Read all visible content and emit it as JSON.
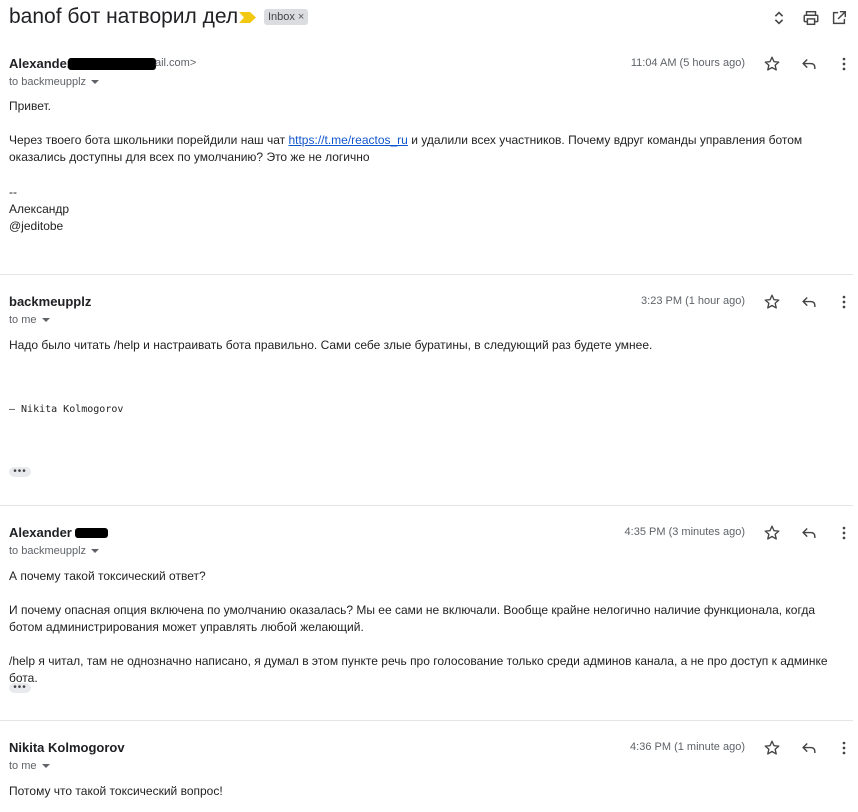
{
  "subject": {
    "title": "banof бот натворил дел",
    "label": "Inbox",
    "label_remove": "×"
  },
  "colors": {
    "importance": "#f2c811",
    "link": "#1155cc"
  },
  "top_actions": [
    "expand-collapse-icon",
    "print-icon",
    "open-in-new-window-icon"
  ],
  "messages": [
    {
      "sender": "Alexander",
      "email_tail": "ail.com>",
      "recipient": "to backmeupplz",
      "time": "11:04 AM (5 hours ago)",
      "body": {
        "greeting": "Привет.",
        "p1_before": "Через твоего бота  школьники порейдили наш чат ",
        "link": "https://t.me/reactos_ru",
        "p1_after": " и удалили всех участников. Почему вдруг команды управления ботом оказались доступны для всех по умолчанию? Это же не логично",
        "sig_sep": "--",
        "sig_name": "Александр",
        "sig_handle": "@jeditobe"
      }
    },
    {
      "sender": "backmeupplz",
      "recipient": "to me",
      "time": "3:23 PM (1 hour ago)",
      "body": {
        "text": "Надо было читать /help и настраивать бота правильно. Сами себе злые буратины, в следующий раз будете умнее.",
        "signature": "— Nikita Kolmogorov"
      },
      "more": "•••"
    },
    {
      "sender": "Alexander",
      "recipient": "to backmeupplz",
      "time": "4:35 PM (3 minutes ago)",
      "body": {
        "p1": "А почему такой токсический ответ?",
        "p2": "И почему опасная опция включена по умолчанию оказалась? Мы ее сами не включали. Вообще крайне нелогично наличие функционала, когда ботом администрирования может управлять любой желающий.",
        "p3": "/help я читал, там не однозначно написано, я думал в этом пункте речь про голосование только среди админов канала, а не про доступ к админке бота."
      },
      "more": "•••"
    },
    {
      "sender": "Nikita Kolmogorov",
      "recipient": "to me",
      "time": "4:36 PM (1 minute ago)",
      "body": {
        "text": "Потому что такой токсический вопрос!"
      }
    }
  ]
}
